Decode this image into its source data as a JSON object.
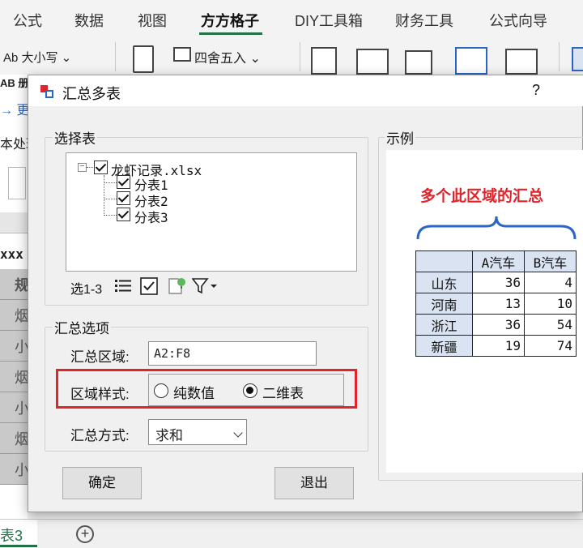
{
  "ribbon_tabs": [
    "公式",
    "数据",
    "视图",
    "方方格子",
    "DIY工具箱",
    "财务工具",
    "公式向导"
  ],
  "active_tab": "方方格子",
  "ribbon": {
    "case_button": "Ab 大小写 ⌄",
    "round_button": "四舍五入 ⌄",
    "partial_left_1": "AB 册",
    "partial_left_2": "→ 更",
    "partial_left_3": "本处理"
  },
  "sheet": {
    "header_fragment": "xxx",
    "column_chars": [
      "规",
      "烟",
      "小",
      "烟",
      "小",
      "烟",
      "小"
    ],
    "sheet_tab": "表3",
    "add_sheet": "+"
  },
  "dialog": {
    "title": "汇总多表",
    "help": "?",
    "select_group_label": "选择表",
    "tree": {
      "root": "龙虾记录.xlsx",
      "children": [
        "分表1",
        "分表2",
        "分表3"
      ],
      "expander": "−"
    },
    "tree_toolbar": {
      "selection_text": "选1-3"
    },
    "options_group_label": "汇总选项",
    "area_label": "汇总区域:",
    "area_value": "A2:F8",
    "style_label": "区域样式:",
    "style_options": [
      "纯数值",
      "二维表"
    ],
    "style_selected_index": 1,
    "method_label": "汇总方式:",
    "method_value": "求和",
    "ok_button": "确定",
    "exit_button": "退出",
    "example_label": "示例",
    "example": {
      "heading": "多个此区域的汇总",
      "columns": [
        "",
        "A汽车",
        "B汽车"
      ],
      "rows": [
        [
          "山东",
          "36",
          "4"
        ],
        [
          "河南",
          "13",
          "10"
        ],
        [
          "浙江",
          "36",
          "54"
        ],
        [
          "新疆",
          "19",
          "74"
        ]
      ]
    }
  },
  "colors": {
    "highlight": "#e2232a",
    "accent": "#217346",
    "table_header": "#d9e3f1",
    "brace": "#2b66c2"
  }
}
